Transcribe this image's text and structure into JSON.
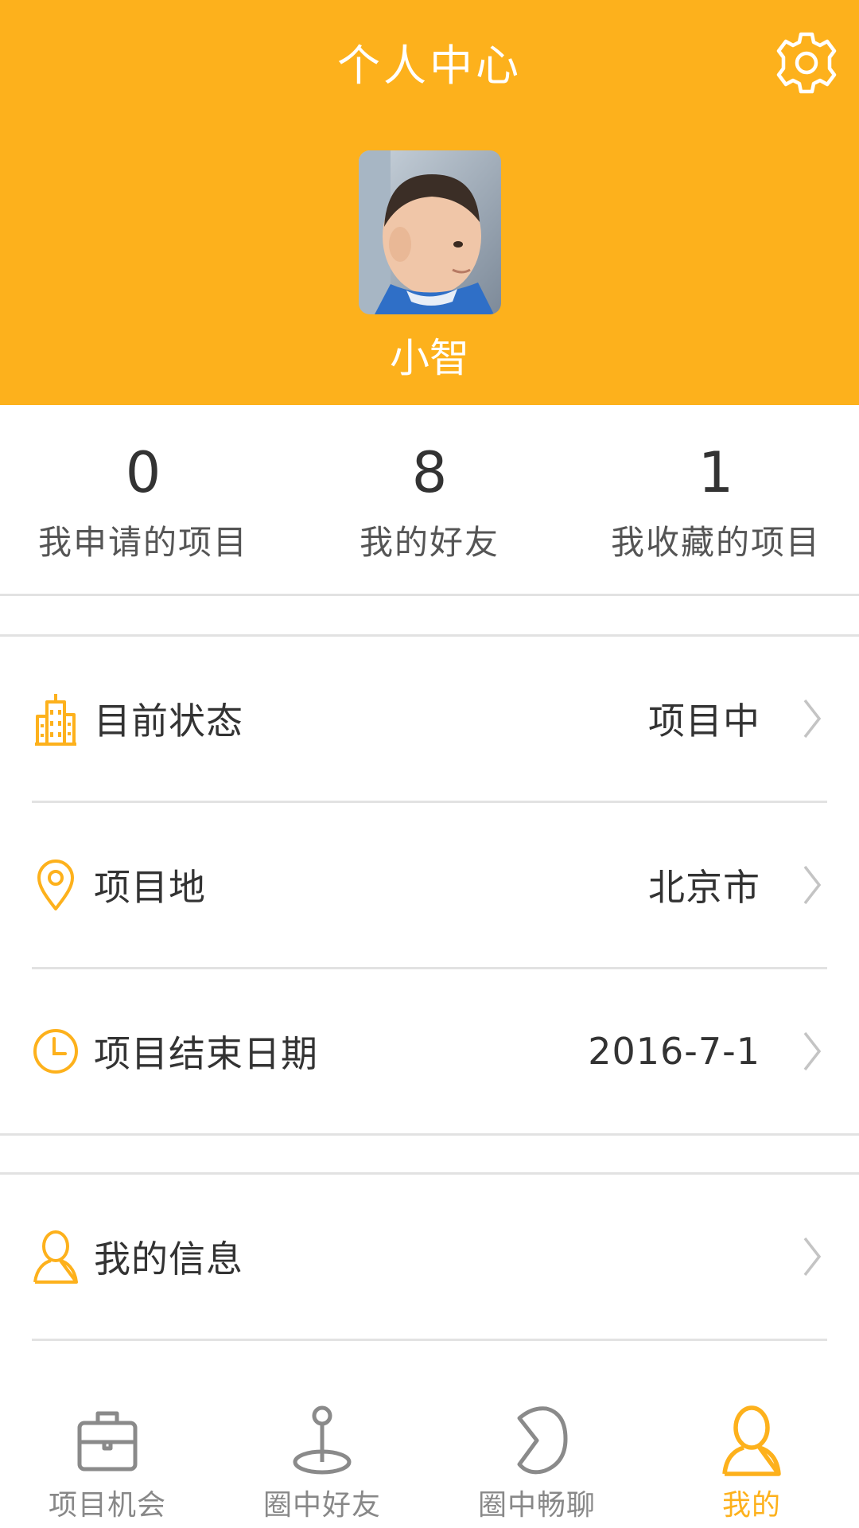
{
  "colors": {
    "accent": "#fdb11c",
    "text": "#333333",
    "muted": "#888888",
    "divider": "#e2e2e2"
  },
  "header": {
    "title": "个人中心",
    "settings_icon": "gear-icon"
  },
  "profile": {
    "name": "小智",
    "avatar_icon": "avatar-photo"
  },
  "stats": [
    {
      "count": "0",
      "label": "我申请的项目"
    },
    {
      "count": "8",
      "label": "我的好友"
    },
    {
      "count": "1",
      "label": "我收藏的项目"
    }
  ],
  "rows": {
    "status": {
      "label": "目前状态",
      "value": "项目中",
      "icon": "building-icon"
    },
    "location": {
      "label": "项目地",
      "value": "北京市",
      "icon": "location-pin-icon"
    },
    "end_date": {
      "label": "项目结束日期",
      "value": "2016-7-1",
      "icon": "clock-icon"
    },
    "my_info": {
      "label": "我的信息",
      "icon": "person-icon"
    }
  },
  "tabs": [
    {
      "label": "项目机会",
      "icon": "briefcase-icon",
      "active": false
    },
    {
      "label": "圈中好友",
      "icon": "pin-icon",
      "active": false
    },
    {
      "label": "圈中畅聊",
      "icon": "chat-bubble-icon",
      "active": false
    },
    {
      "label": "我的",
      "icon": "person-icon",
      "active": true
    }
  ]
}
